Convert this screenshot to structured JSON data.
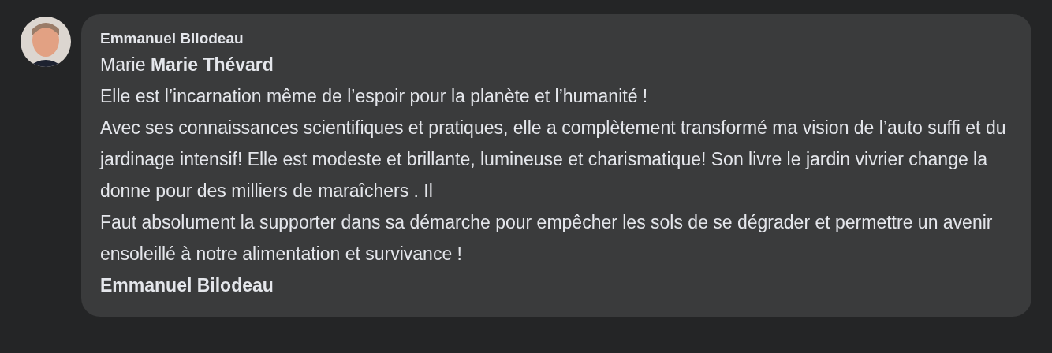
{
  "comment": {
    "author": "Emmanuel Bilodeau",
    "lead": "Marie",
    "mention": "Marie Thévard",
    "paragraphs": [
      "Elle est l’incarnation même de l’espoir pour la planète et l’humanité !",
      "Avec ses connaissances scientifiques et pratiques, elle a complètement transformé ma vision de l’auto suffi et du jardinage intensif! Elle est modeste et brillante, lumineuse et charismatique! Son livre le jardin vivrier change la donne pour des milliers de maraîchers . Il",
      "Faut absolument la supporter dans sa démarche pour empêcher les sols de se dégrader et permettre un avenir ensoleillé à notre alimentation et survivance !"
    ],
    "signature": "Emmanuel Bilodeau"
  }
}
